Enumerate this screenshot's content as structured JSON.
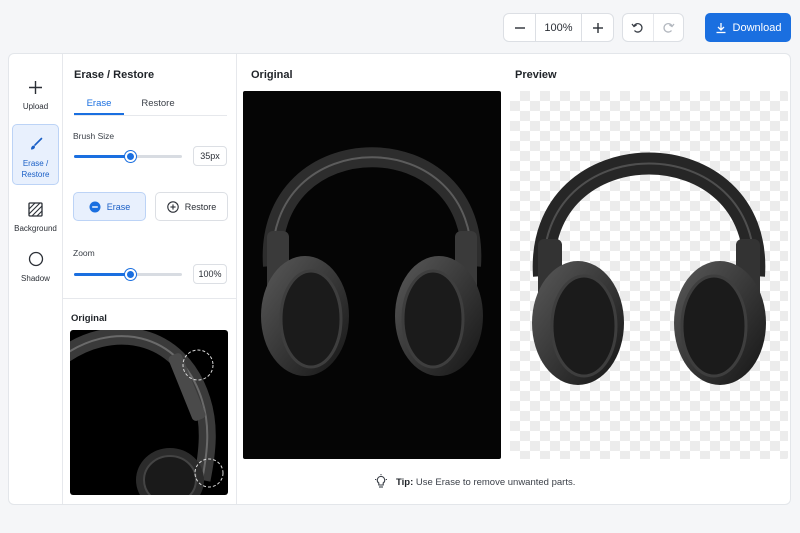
{
  "toolbar": {
    "zoom_value": "100%",
    "zoom_out_icon": "minus-icon",
    "zoom_in_icon": "plus-icon",
    "undo_icon": "undo-icon",
    "redo_icon": "redo-icon",
    "download_label": "Download",
    "download_icon": "download-icon",
    "accent_color": "#1a6fe0"
  },
  "rail": {
    "items": [
      {
        "label": "Upload",
        "icon": "plus-icon"
      },
      {
        "label": "Erase / Restore",
        "icon": "brush-icon",
        "active": true
      },
      {
        "label": "Background",
        "icon": "hatch-square-icon"
      },
      {
        "label": "Shadow",
        "icon": "circle-icon"
      }
    ]
  },
  "panel": {
    "title": "Erase / Restore",
    "tabs": [
      {
        "label": "Erase",
        "active": true
      },
      {
        "label": "Restore"
      }
    ],
    "brush_size_label": "Brush Size",
    "brush_size_value": "35px",
    "brush_size_level": 0.52,
    "erase_button": "Erase",
    "restore_button": "Restore",
    "zoom_label": "Zoom",
    "zoom_value": "100%",
    "zoom_level": 0.52,
    "mini_title": "Original"
  },
  "canvas": {
    "original_title": "Original",
    "preview_title": "Preview",
    "tip_label": "Tip:",
    "tip_text": "Use Erase to remove unwanted parts.",
    "tip_icon": "lightbulb-icon"
  }
}
